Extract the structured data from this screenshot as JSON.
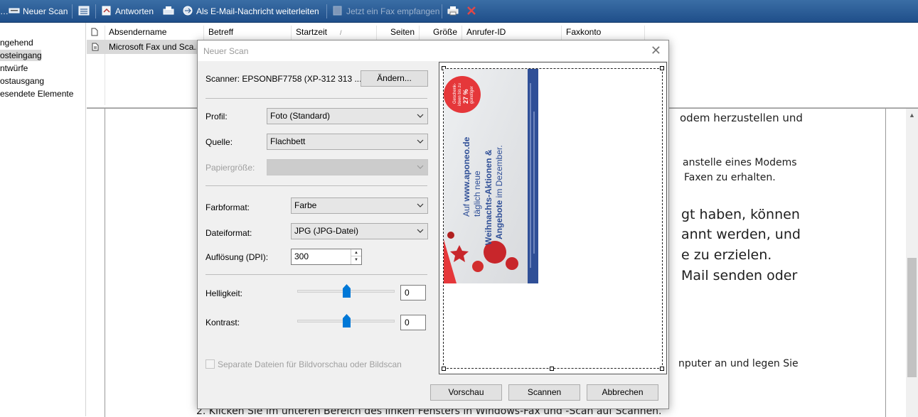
{
  "toolbar": {
    "new_scan": "Neuer Scan",
    "reply": "Antworten",
    "forward_email": "Als E-Mail-Nachricht weiterleiten",
    "receive_fax": "Jetzt ein Fax empfangen"
  },
  "sidebar": {
    "items": [
      {
        "label": "ngehend"
      },
      {
        "label": "osteingang"
      },
      {
        "label": "ntwürfe"
      },
      {
        "label": "ostausgang"
      },
      {
        "label": "esendete Elemente"
      }
    ]
  },
  "list": {
    "columns": [
      "Absendername",
      "Betreff",
      "Startzeit",
      "Seiten",
      "Größe",
      "Anrufer-ID",
      "Faxkonto"
    ],
    "rows": [
      {
        "sender": "Microsoft Fax und Sca..."
      }
    ]
  },
  "document": {
    "lines": [
      "odem herzustellen und",
      "anstelle eines Modems",
      "Faxen zu erhalten.",
      "gt haben, können",
      "annt werden, und",
      "e zu erzielen.",
      "Mail senden oder",
      "nputer an und legen Sie",
      "2.    Klicken Sie im unteren Bereich des linken Fensters in Windows-Fax und -Scan auf Scannen."
    ]
  },
  "dialog": {
    "title": "Neuer Scan",
    "scanner_label": "Scanner: EPSONBF7758 (XP-312 313 ...",
    "change_button": "Ändern...",
    "profile_label": "Profil:",
    "profile_value": "Foto (Standard)",
    "source_label": "Quelle:",
    "source_value": "Flachbett",
    "paper_label": "Papiergröße:",
    "paper_value": "",
    "color_label": "Farbformat:",
    "color_value": "Farbe",
    "file_label": "Dateiformat:",
    "file_value": "JPG (JPG-Datei)",
    "dpi_label": "Auflösung (DPI):",
    "dpi_value": "300",
    "brightness_label": "Helligkeit:",
    "brightness_value": "0",
    "contrast_label": "Kontrast:",
    "contrast_value": "0",
    "separate_files_label": "Separate Dateien für Bildvorschau oder Bildscan",
    "preview_button": "Vorschau",
    "scan_button": "Scannen",
    "cancel_button": "Abbrechen"
  },
  "flyer": {
    "badge_line1": "Geschenk-",
    "badge_line2": "ideen bis zu",
    "badge_pct": "27 %",
    "badge_line3": "günstiger",
    "line1_prefix": "Auf ",
    "line1_url": "www.aponeo.de",
    "line2": "täglich neue",
    "line3": "Weihnachts-Aktionen &",
    "line4_bold": "Angebote",
    "line4_rest": " im Dezember."
  },
  "colors": {
    "toolbar_top": "#3a6ea5",
    "toolbar_bottom": "#1f4f8a",
    "dialog_bg": "#f0f0f0",
    "slider_thumb": "#0078d7",
    "flyer_red": "#e5373a",
    "flyer_blue": "#2f4f97"
  }
}
